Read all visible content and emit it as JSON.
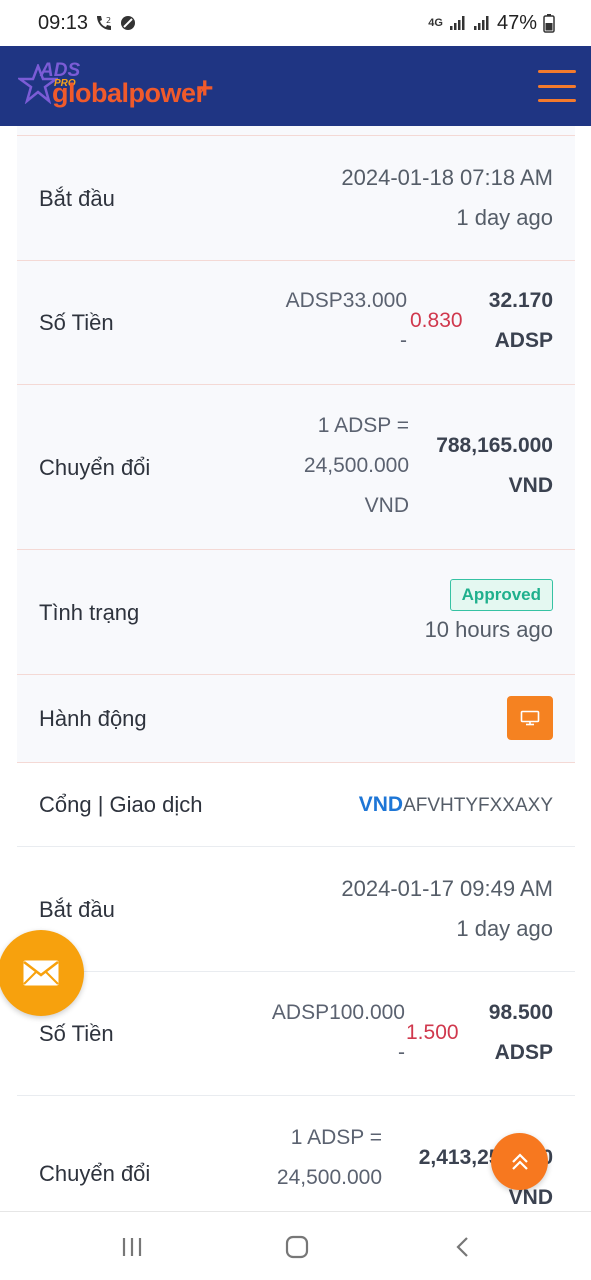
{
  "status_bar": {
    "time": "09:13",
    "network": "4G",
    "battery": "47%"
  },
  "header": {
    "logo_ads": "ADS",
    "logo_pro": "PRO",
    "logo_text": "globalpower",
    "logo_plus": "+"
  },
  "records": [
    {
      "start_label": "Bắt đầu",
      "start_date": "2024-01-18 07:18 AM",
      "start_ago": "1 day ago",
      "amount_label": "Số Tiền",
      "amount_orig": "ADSP33.000",
      "amount_dash": "-",
      "amount_fee": "0.830",
      "amount_final": "32.170",
      "amount_unit": "ADSP",
      "convert_label": "Chuyển đổi",
      "rate_line1": "1 ADSP =",
      "rate_line2": "24,500.000",
      "rate_line3": "VND",
      "convert_value": "788,165.000",
      "convert_unit": "VND",
      "status_label": "Tình trạng",
      "status_badge": "Approved",
      "status_ago": "10 hours ago",
      "action_label": "Hành động"
    },
    {
      "gateway_label": "Cổng | Giao dịch",
      "gateway_currency": "VND",
      "gateway_code": "AFVHTYFXXAXY",
      "start_label": "Bắt đầu",
      "start_date": "2024-01-17 09:49 AM",
      "start_ago": "1 day ago",
      "amount_label": "Số Tiền",
      "amount_orig": "ADSP100.000",
      "amount_dash": "-",
      "amount_fee": "1.500",
      "amount_final": "98.500",
      "amount_unit": "ADSP",
      "convert_label": "Chuyển đổi",
      "rate_line1": "1 ADSP =",
      "rate_line2": "24,500.000",
      "convert_value": "2,413,250.000",
      "convert_unit": "VND"
    }
  ],
  "colors": {
    "header_bg": "#1f3583",
    "accent_orange": "#f58221",
    "fee_red": "#d0384d",
    "approved_green": "#1fb08d",
    "gateway_blue": "#1e76d6"
  }
}
